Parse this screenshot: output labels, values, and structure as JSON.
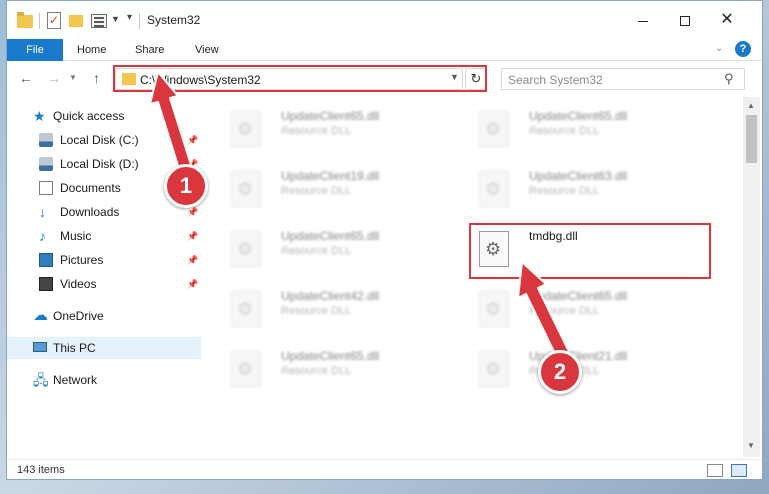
{
  "window": {
    "title": "System32",
    "min_symbol": "",
    "max_symbol": "",
    "close_symbol": "✕"
  },
  "ribbon": {
    "tabs": [
      "File",
      "Home",
      "Share",
      "View"
    ],
    "help_symbol": "?"
  },
  "address": {
    "path": "C:\\Windows\\System32",
    "search_placeholder": "Search System32"
  },
  "nav": {
    "items": [
      {
        "label": "Quick access",
        "icon": "star-icon"
      },
      {
        "label": "Local Disk (C:)",
        "icon": "disk-icon"
      },
      {
        "label": "Local Disk (D:)",
        "icon": "disk-icon"
      },
      {
        "label": "Documents",
        "icon": "documents-icon"
      },
      {
        "label": "Downloads",
        "icon": "download-icon"
      },
      {
        "label": "Music",
        "icon": "music-icon"
      },
      {
        "label": "Pictures",
        "icon": "pictures-icon"
      },
      {
        "label": "Videos",
        "icon": "videos-icon"
      },
      {
        "label": "OneDrive",
        "icon": "cloud-icon"
      },
      {
        "label": "This PC",
        "icon": "computer-icon"
      },
      {
        "label": "Network",
        "icon": "network-icon"
      }
    ]
  },
  "files": [
    {
      "name": "UpdateClient65.dll",
      "type": "Resource DLL"
    },
    {
      "name": "UpdateClient65.dll",
      "type": "Resource DLL"
    },
    {
      "name": "UpdateClient19.dll",
      "type": "Resource DLL"
    },
    {
      "name": "UpdateClient63.dll",
      "type": "Resource DLL"
    },
    {
      "name": "UpdateClient65.dll",
      "type": "Resource DLL"
    },
    {
      "name": "tmdbg.dll",
      "type": ""
    },
    {
      "name": "UpdateClient42.dll",
      "type": "Resource DLL"
    },
    {
      "name": "UpdateClient65.dll",
      "type": "Resource DLL"
    },
    {
      "name": "UpdateClient65.dll",
      "type": "Resource DLL"
    },
    {
      "name": "UpdateClient21.dll",
      "type": "Resource DLL"
    }
  ],
  "status": {
    "item_count": "143 items"
  },
  "callouts": {
    "step1": "1",
    "step2": "2"
  },
  "colors": {
    "accent": "#1979ca",
    "highlight": "#d9363e",
    "selection": "#e5f1fb"
  }
}
